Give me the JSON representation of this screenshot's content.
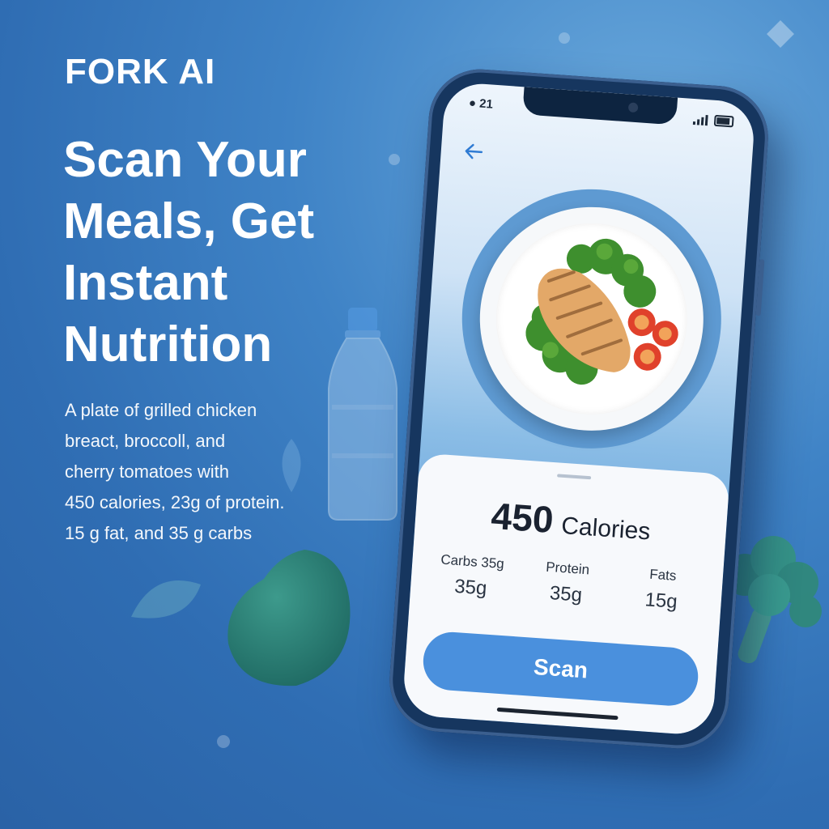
{
  "brand": "FORK AI",
  "headline": "Scan Your Meals, Get Instant Nutrition",
  "description": "A plate of grilled chicken\nbreact, broccoll, and\ncherry tomatoes with\n450 calories, 23g of protein.\n15 g fat, and 35 g carbs",
  "phone": {
    "status_time": "21",
    "back_icon": "arrow-left-icon",
    "nutrition": {
      "calories_value": "450",
      "calories_label": "Calories",
      "carbs_label": "Carbs 35g",
      "carbs_value": "35g",
      "protein_label": "Protein",
      "protein_value": "35g",
      "fats_label": "Fats",
      "fats_value": "15g"
    },
    "scan_label": "Scan"
  },
  "colors": {
    "accent": "#4a90dd",
    "background": "#3f83c6"
  }
}
